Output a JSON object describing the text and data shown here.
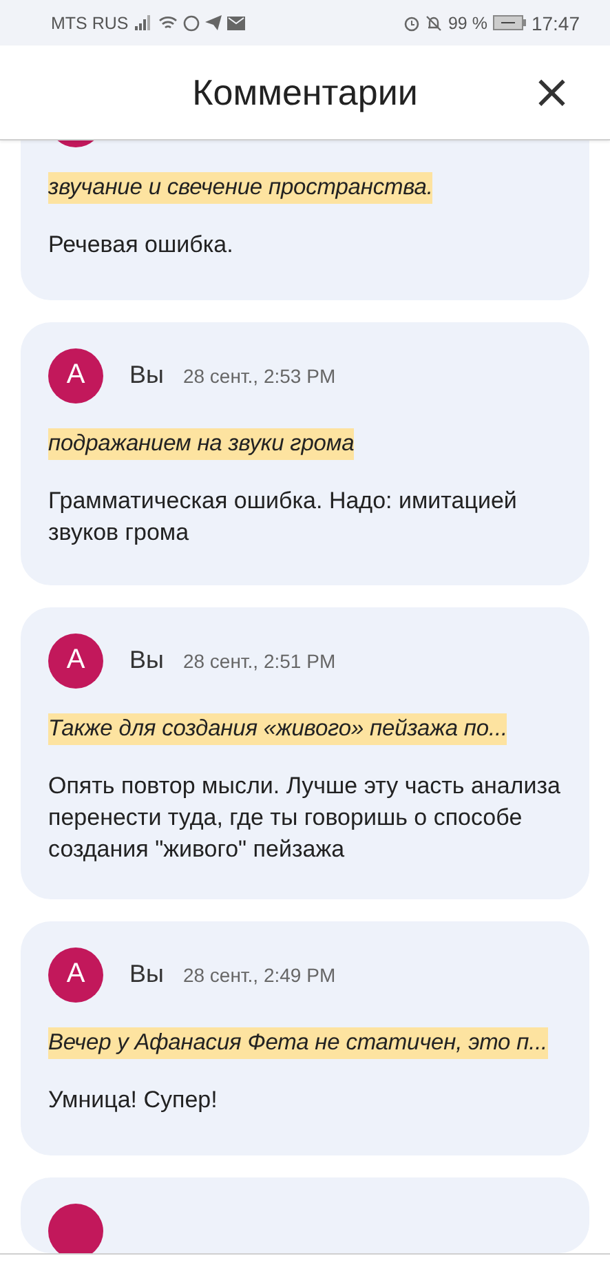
{
  "status_bar": {
    "carrier": "MTS RUS",
    "battery": "99 %",
    "time": "17:47"
  },
  "header": {
    "title": "Комментарии",
    "close": "×"
  },
  "comments": [
    {
      "kind": "partial-top",
      "quote": "звучание и свечение пространства.",
      "text": "Речевая ошибка."
    },
    {
      "kind": "full",
      "avatar": "A",
      "author": "Вы",
      "time": "28 сент., 2:53 PM",
      "quote": "подражанием на звуки грома",
      "text": "Грамматическая ошибка. Надо: имитацией звуков грома"
    },
    {
      "kind": "full",
      "avatar": "A",
      "author": "Вы",
      "time": "28 сент., 2:51 PM",
      "quote": "Также для создания «живого» пейзажа по...",
      "text": "Опять повтор мысли. Лучше эту часть анализа перенести туда, где ты говоришь о способе создания \"живого\" пейзажа"
    },
    {
      "kind": "full",
      "avatar": "A",
      "author": "Вы",
      "time": "28 сент., 2:49 PM",
      "quote": "Вечер у Афанасия Фета не статичен, это п...",
      "text": "Умница! Супер!"
    },
    {
      "kind": "partial-bottom"
    }
  ]
}
